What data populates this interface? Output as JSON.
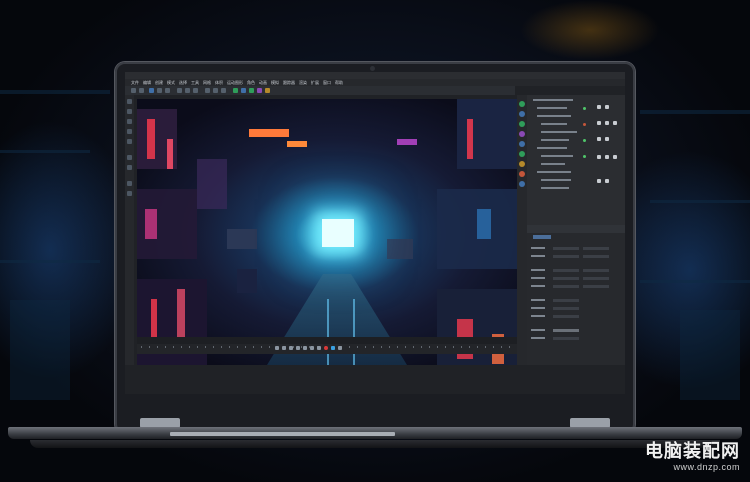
{
  "scene": {
    "description_colors": {
      "accent_cyan": "#4fd3ea",
      "accent_red": "#ff3b4f",
      "accent_orange": "#ff8a3a",
      "frame": "#1b1d22"
    }
  },
  "app": {
    "menu": [
      "文件",
      "编辑",
      "创建",
      "模式",
      "选择",
      "工具",
      "网格",
      "体积",
      "运动图形",
      "角色",
      "动画",
      "模拟",
      "跟踪器",
      "渲染",
      "扩展",
      "窗口",
      "帮助"
    ]
  },
  "watermark": {
    "site_name": "电脑装配网",
    "url": "www.dnzp.com"
  }
}
